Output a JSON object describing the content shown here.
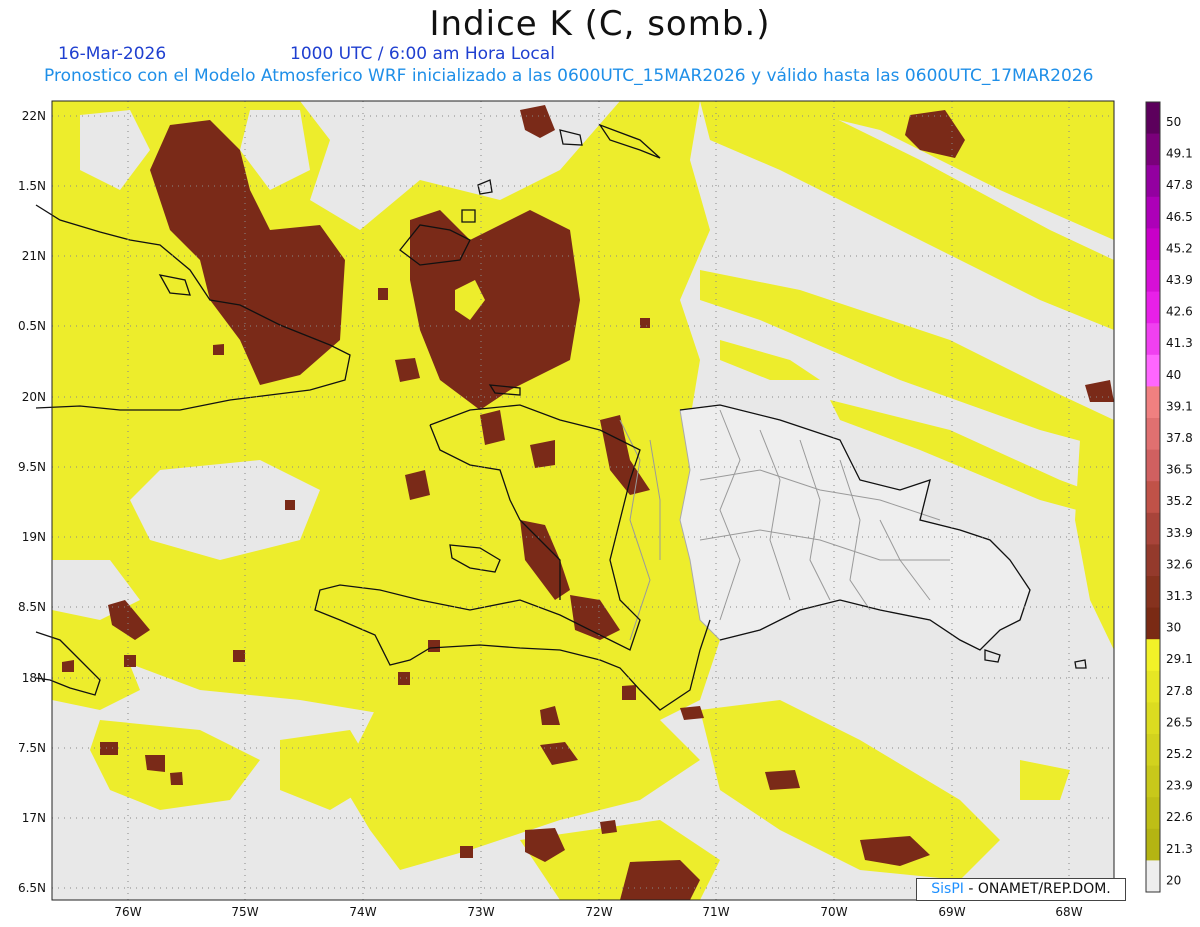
{
  "header": {
    "title": "Indice K (C, somb.)",
    "date": "16-Mar-2026",
    "time": "1000 UTC / 6:00 am Hora Local",
    "forecast_line": "Pronostico con el Modelo Atmosferico WRF inicializado a las 0600UTC_15MAR2026 y válido hasta las  0600UTC_17MAR2026"
  },
  "map": {
    "lat_labels": [
      "22N",
      "1.5N",
      "21N",
      "0.5N",
      "20N",
      "9.5N",
      "19N",
      "8.5N",
      "18N",
      "7.5N",
      "17N",
      "6.5N"
    ],
    "lon_labels": [
      "76W",
      "75W",
      "74W",
      "73W",
      "72W",
      "71W",
      "70W",
      "69W",
      "68W"
    ],
    "colors": {
      "ocean_no_data": "#e8e8e8",
      "moderate": "#eded2c",
      "high": "#7a2a18",
      "coastline": "#111111",
      "boundaries": "#999999"
    }
  },
  "legend": {
    "labels": [
      "50",
      "49.1",
      "47.8",
      "46.5",
      "45.2",
      "43.9",
      "42.6",
      "41.3",
      "40",
      "39.1",
      "37.8",
      "36.5",
      "35.2",
      "33.9",
      "32.6",
      "31.3",
      "30",
      "29.1",
      "27.8",
      "26.5",
      "25.2",
      "23.9",
      "22.6",
      "21.3",
      "20"
    ],
    "colors": [
      "#5c005c",
      "#7a007a",
      "#9300a0",
      "#ad00b8",
      "#c800c8",
      "#d610d6",
      "#e820e8",
      "#f040f0",
      "#ff66ff",
      "#f08080",
      "#e07070",
      "#d06060",
      "#c05248",
      "#a8443a",
      "#943a2c",
      "#86321e",
      "#7a2a14",
      "#f2f228",
      "#e6e624",
      "#dcdc20",
      "#d2d21e",
      "#c8c81a",
      "#bebe16",
      "#b4b412",
      "#eeeeee"
    ]
  },
  "credit": {
    "brand": "SisPI",
    "text": "- ONAMET/REP.DOM."
  }
}
